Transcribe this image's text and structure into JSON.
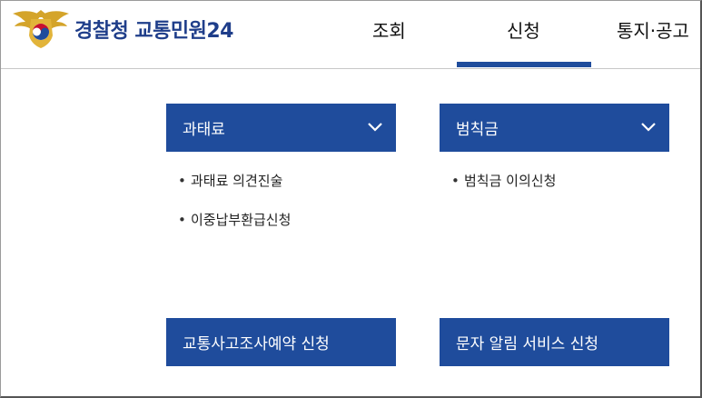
{
  "brand": {
    "logo_icon": "police-emblem-icon",
    "name": "경찰청 교통민원24",
    "colors": {
      "primary": "#1f4c9c",
      "logo_text": "#1f3e8a",
      "emblem_gold": "#d4a42a"
    }
  },
  "nav": {
    "items": [
      {
        "label": "조회"
      },
      {
        "label": "신청"
      },
      {
        "label": "통지·공고"
      }
    ],
    "active_index": 1
  },
  "panels": [
    {
      "title": "과태료",
      "icon": "chevron-down-icon",
      "items": [
        "과태료 의견진술",
        "이중납부환급신청"
      ]
    },
    {
      "title": "범칙금",
      "icon": "chevron-down-icon",
      "items": [
        "범칙금 이의신청"
      ]
    }
  ],
  "buttons": {
    "accident_investigation": "교통사고조사예약 신청",
    "sms_alert": "문자 알림 서비스 신청"
  }
}
